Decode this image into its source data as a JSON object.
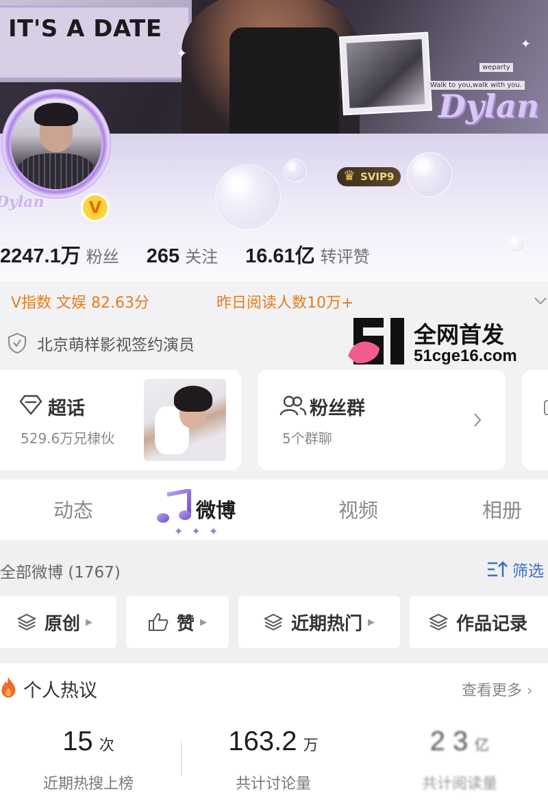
{
  "banner": {
    "sign_text": "IT'S A DATE",
    "tag_weparty": "weparty",
    "tag_walk": "Walk to you,walk with you.",
    "script_name": "Dylan"
  },
  "profile": {
    "avatar_script": "Dylan",
    "verified_badge": "V",
    "svip_label": "SVIP9"
  },
  "stats": [
    {
      "value": "2247.1万",
      "label": "粉丝"
    },
    {
      "value": "265",
      "label": "关注"
    },
    {
      "value": "16.61亿",
      "label": "转评赞"
    }
  ],
  "info": {
    "v_index": "V指数 文娱 82.63分",
    "yesterday_reads": "昨日阅读人数10万+",
    "certification": "北京萌样影视签约演员"
  },
  "watermark": {
    "line1": "全网首发",
    "line2": "51cge16.com"
  },
  "cards": {
    "supertopic": {
      "title": "超话",
      "subtitle": "529.6万兄棣伙"
    },
    "fan_group": {
      "title": "粉丝群",
      "subtitle": "5个群聊"
    }
  },
  "tabs": [
    {
      "label": "动态",
      "active": false
    },
    {
      "label": "微博",
      "active": true
    },
    {
      "label": "视频",
      "active": false
    },
    {
      "label": "相册",
      "active": false
    }
  ],
  "feed": {
    "all_label": "全部微博 (1767)",
    "filter_label": "筛选",
    "chips": [
      "原创",
      "赞",
      "近期热门",
      "作品记录"
    ]
  },
  "hot_discussion": {
    "title": "个人热议",
    "more": "查看更多",
    "stats": [
      {
        "value": "15",
        "unit": "次",
        "label": "近期热搜上榜"
      },
      {
        "value": "163.2",
        "unit": "万",
        "label": "共计讨论量"
      },
      {
        "value": "2 3",
        "unit": "亿",
        "label": "共计阅读量"
      }
    ]
  },
  "colors": {
    "accent_orange": "#e57c1c",
    "link_blue": "#3b6ecc",
    "theme_purple": "#8f7ad8",
    "watermark_pink": "#f25c8c"
  }
}
